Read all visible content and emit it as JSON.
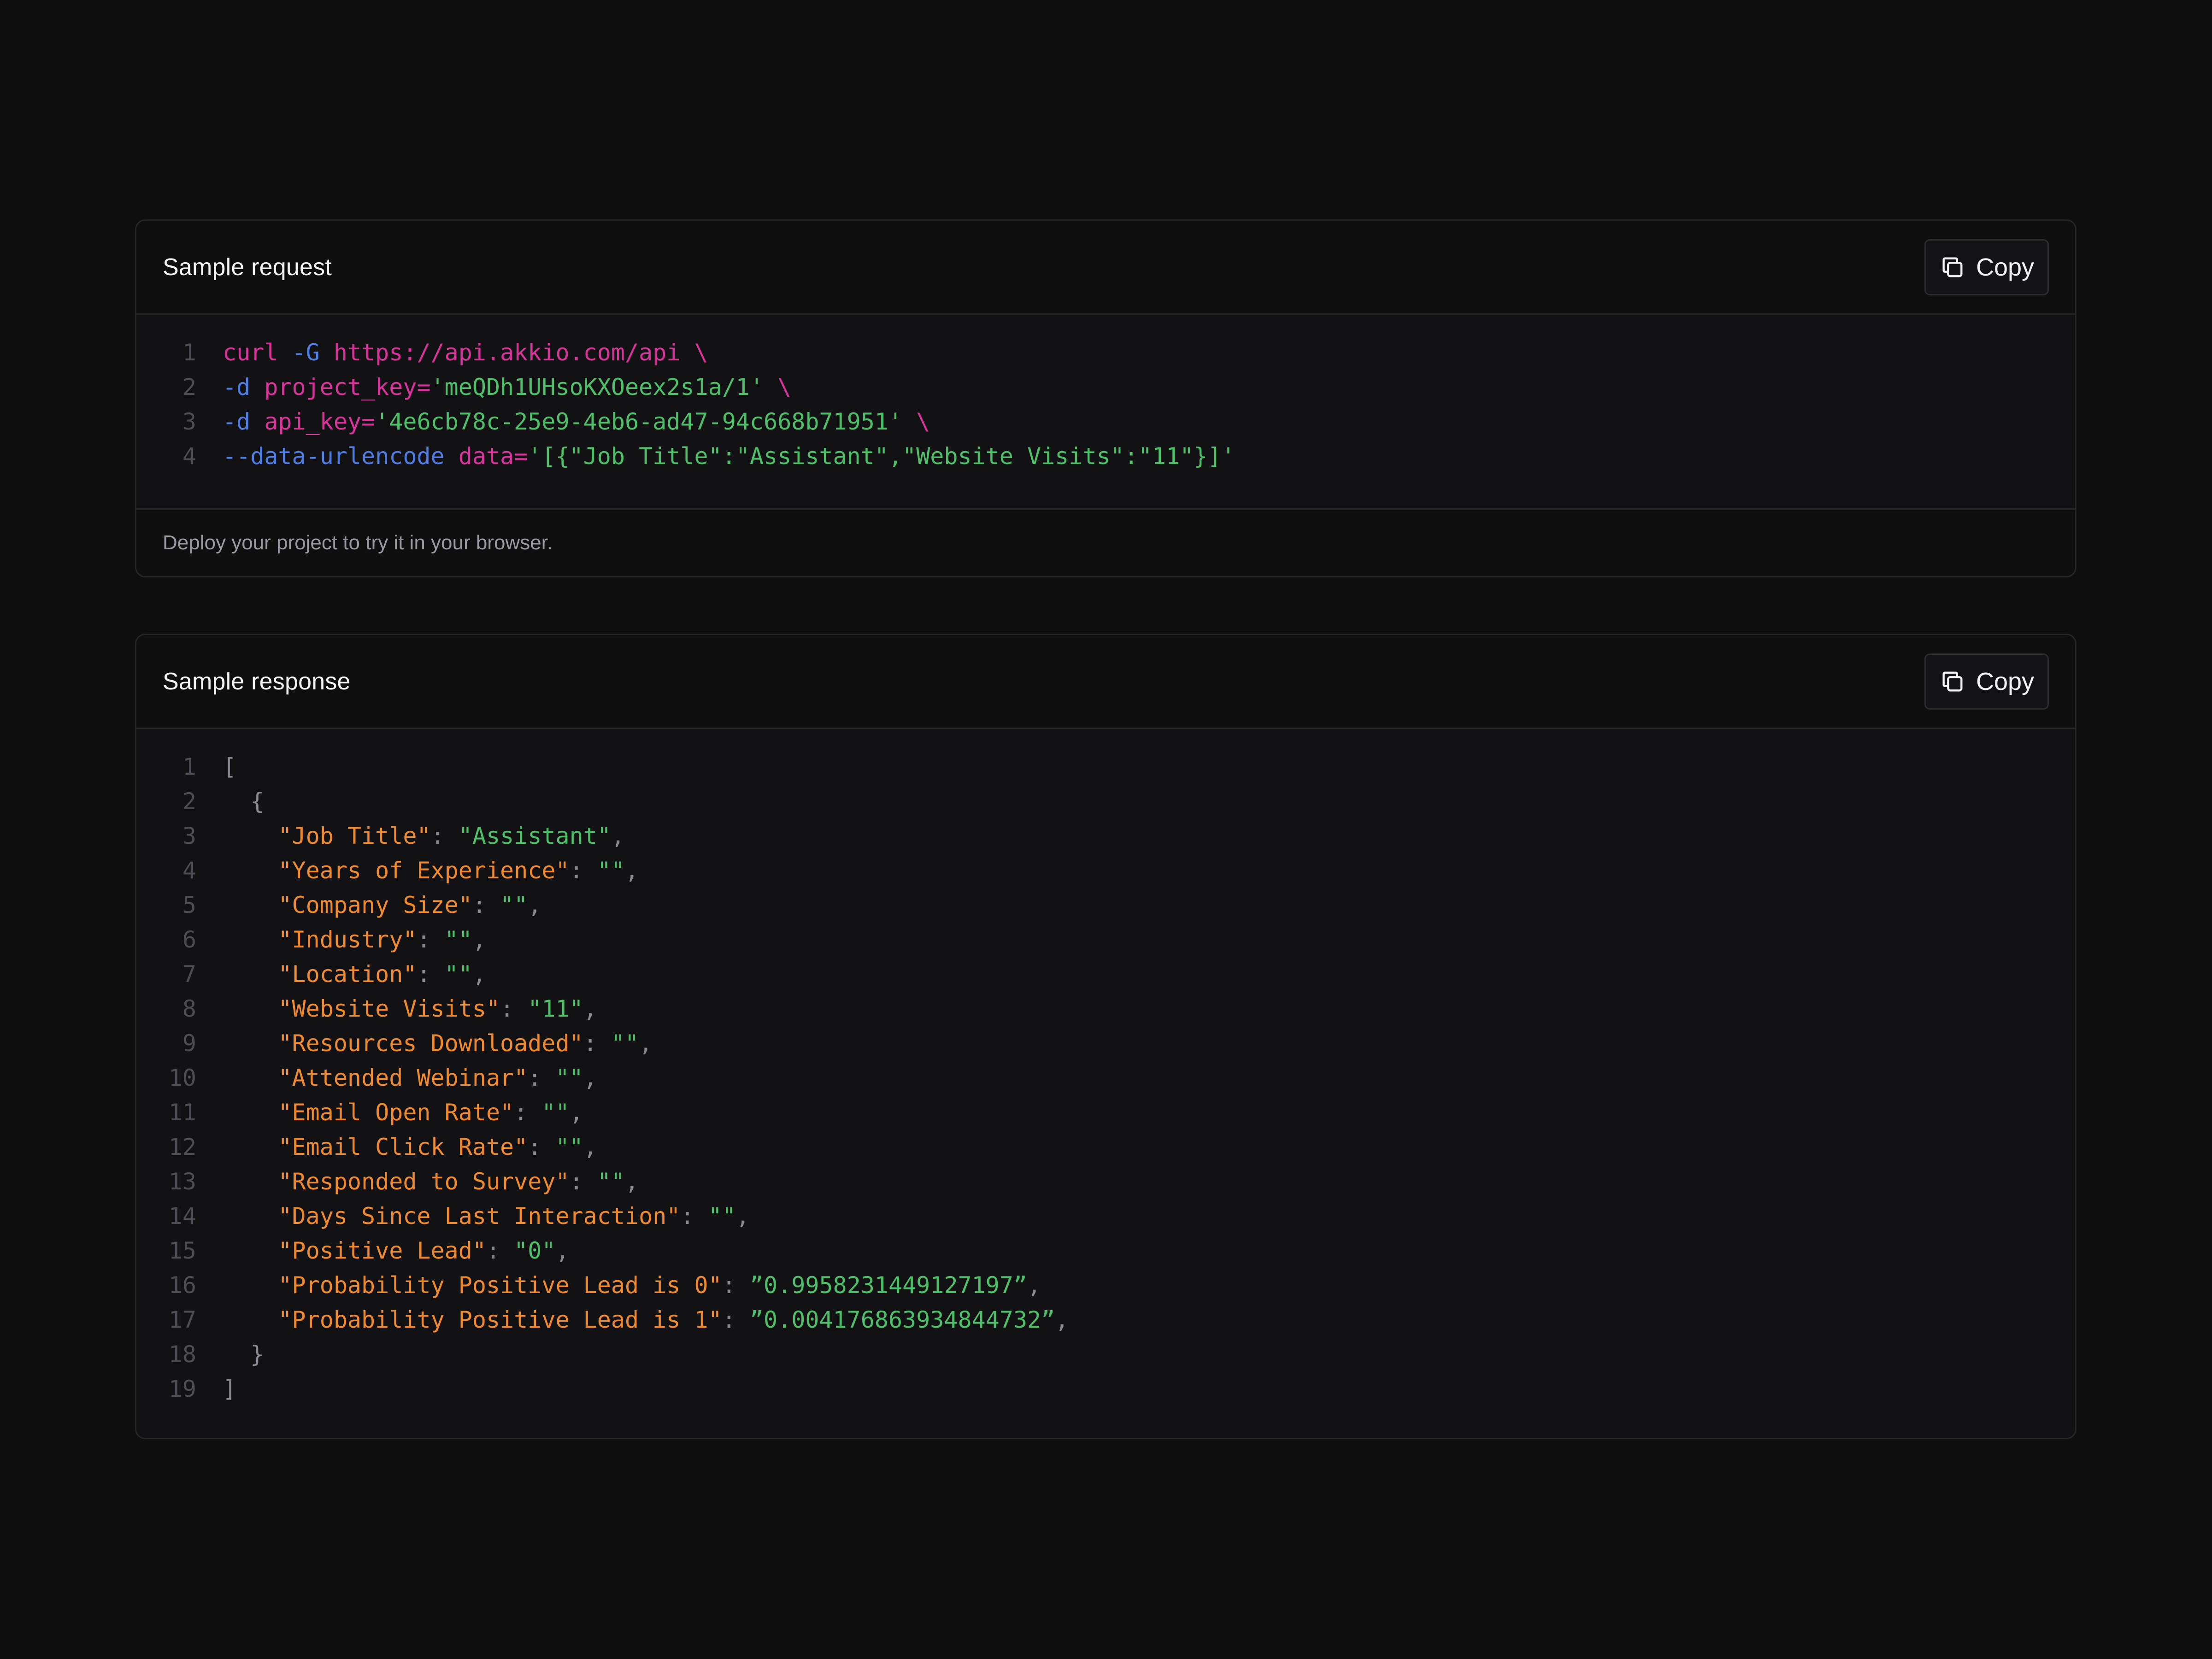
{
  "request_panel": {
    "title": "Sample request",
    "copy_label": "Copy",
    "footer": "Deploy your project to try it in your browser.",
    "lines": [
      {
        "num": "1",
        "tokens": [
          {
            "t": "cmd",
            "v": "curl "
          },
          {
            "t": "flag",
            "v": "-G "
          },
          {
            "t": "cmd",
            "v": "https://api.akkio.com/api \\"
          }
        ]
      },
      {
        "num": "2",
        "tokens": [
          {
            "t": "flag",
            "v": "-d "
          },
          {
            "t": "key",
            "v": "project_key="
          },
          {
            "t": "str",
            "v": "'meQDh1UHsoKXOeex2s1a/1'"
          },
          {
            "t": "cmd",
            "v": " \\"
          }
        ]
      },
      {
        "num": "3",
        "tokens": [
          {
            "t": "flag",
            "v": "-d "
          },
          {
            "t": "key",
            "v": "api_key="
          },
          {
            "t": "str",
            "v": "'4e6cb78c-25e9-4eb6-ad47-94c668b71951'"
          },
          {
            "t": "cmd",
            "v": " \\"
          }
        ]
      },
      {
        "num": "4",
        "tokens": [
          {
            "t": "flag",
            "v": "--data-urlencode "
          },
          {
            "t": "key",
            "v": "data="
          },
          {
            "t": "str",
            "v": "'[{\"Job Title\":\"Assistant\",\"Website Visits\":\"11\"}]'"
          }
        ]
      }
    ]
  },
  "response_panel": {
    "title": "Sample response",
    "copy_label": "Copy",
    "lines": [
      {
        "num": "1",
        "tokens": [
          {
            "t": "punct",
            "v": "["
          }
        ]
      },
      {
        "num": "2",
        "tokens": [
          {
            "t": "punct",
            "v": "  {"
          }
        ]
      },
      {
        "num": "3",
        "tokens": [
          {
            "t": "jkey",
            "v": "    \"Job Title\""
          },
          {
            "t": "punct",
            "v": ": "
          },
          {
            "t": "str",
            "v": "\"Assistant\""
          },
          {
            "t": "punct",
            "v": ","
          }
        ]
      },
      {
        "num": "4",
        "tokens": [
          {
            "t": "jkey",
            "v": "    \"Years of Experience\""
          },
          {
            "t": "punct",
            "v": ": "
          },
          {
            "t": "str",
            "v": "\"\""
          },
          {
            "t": "punct",
            "v": ","
          }
        ]
      },
      {
        "num": "5",
        "tokens": [
          {
            "t": "jkey",
            "v": "    \"Company Size\""
          },
          {
            "t": "punct",
            "v": ": "
          },
          {
            "t": "str",
            "v": "\"\""
          },
          {
            "t": "punct",
            "v": ","
          }
        ]
      },
      {
        "num": "6",
        "tokens": [
          {
            "t": "jkey",
            "v": "    \"Industry\""
          },
          {
            "t": "punct",
            "v": ": "
          },
          {
            "t": "str",
            "v": "\"\""
          },
          {
            "t": "punct",
            "v": ","
          }
        ]
      },
      {
        "num": "7",
        "tokens": [
          {
            "t": "jkey",
            "v": "    \"Location\""
          },
          {
            "t": "punct",
            "v": ": "
          },
          {
            "t": "str",
            "v": "\"\""
          },
          {
            "t": "punct",
            "v": ","
          }
        ]
      },
      {
        "num": "8",
        "tokens": [
          {
            "t": "jkey",
            "v": "    \"Website Visits\""
          },
          {
            "t": "punct",
            "v": ": "
          },
          {
            "t": "str",
            "v": "\"11\""
          },
          {
            "t": "punct",
            "v": ","
          }
        ]
      },
      {
        "num": "9",
        "tokens": [
          {
            "t": "jkey",
            "v": "    \"Resources Downloaded\""
          },
          {
            "t": "punct",
            "v": ": "
          },
          {
            "t": "str",
            "v": "\"\""
          },
          {
            "t": "punct",
            "v": ","
          }
        ]
      },
      {
        "num": "10",
        "tokens": [
          {
            "t": "jkey",
            "v": "    \"Attended Webinar\""
          },
          {
            "t": "punct",
            "v": ": "
          },
          {
            "t": "str",
            "v": "\"\""
          },
          {
            "t": "punct",
            "v": ","
          }
        ]
      },
      {
        "num": "11",
        "tokens": [
          {
            "t": "jkey",
            "v": "    \"Email Open Rate\""
          },
          {
            "t": "punct",
            "v": ": "
          },
          {
            "t": "str",
            "v": "\"\""
          },
          {
            "t": "punct",
            "v": ","
          }
        ]
      },
      {
        "num": "12",
        "tokens": [
          {
            "t": "jkey",
            "v": "    \"Email Click Rate\""
          },
          {
            "t": "punct",
            "v": ": "
          },
          {
            "t": "str",
            "v": "\"\""
          },
          {
            "t": "punct",
            "v": ","
          }
        ]
      },
      {
        "num": "13",
        "tokens": [
          {
            "t": "jkey",
            "v": "    \"Responded to Survey\""
          },
          {
            "t": "punct",
            "v": ": "
          },
          {
            "t": "str",
            "v": "\"\""
          },
          {
            "t": "punct",
            "v": ","
          }
        ]
      },
      {
        "num": "14",
        "tokens": [
          {
            "t": "jkey",
            "v": "    \"Days Since Last Interaction\""
          },
          {
            "t": "punct",
            "v": ": "
          },
          {
            "t": "str",
            "v": "\"\""
          },
          {
            "t": "punct",
            "v": ","
          }
        ]
      },
      {
        "num": "15",
        "tokens": [
          {
            "t": "jkey",
            "v": "    \"Positive Lead\""
          },
          {
            "t": "punct",
            "v": ": "
          },
          {
            "t": "str",
            "v": "\"0\""
          },
          {
            "t": "punct",
            "v": ","
          }
        ]
      },
      {
        "num": "16",
        "tokens": [
          {
            "t": "jkey",
            "v": "    \"Probability Positive Lead is 0\""
          },
          {
            "t": "punct",
            "v": ": "
          },
          {
            "t": "str",
            "v": "”0.9958231449127197”"
          },
          {
            "t": "punct",
            "v": ","
          }
        ]
      },
      {
        "num": "17",
        "tokens": [
          {
            "t": "jkey",
            "v": "    \"Probability Positive Lead is 1\""
          },
          {
            "t": "punct",
            "v": ": "
          },
          {
            "t": "str",
            "v": "”0.004176863934844732”"
          },
          {
            "t": "punct",
            "v": ","
          }
        ]
      },
      {
        "num": "18",
        "tokens": [
          {
            "t": "punct",
            "v": "  }"
          }
        ]
      },
      {
        "num": "19",
        "tokens": [
          {
            "t": "punct",
            "v": "]"
          }
        ]
      }
    ]
  },
  "icons": {
    "copy": "copy-icon"
  },
  "colors": {
    "background": "#0e0e0f",
    "panel": "#121214",
    "border": "#26262a",
    "command": "#d9339c",
    "flag": "#4f7fe6",
    "string": "#4fc06a",
    "json_key": "#f08a2e",
    "punctuation": "#8a8a93",
    "line_number": "#4d4d55"
  }
}
